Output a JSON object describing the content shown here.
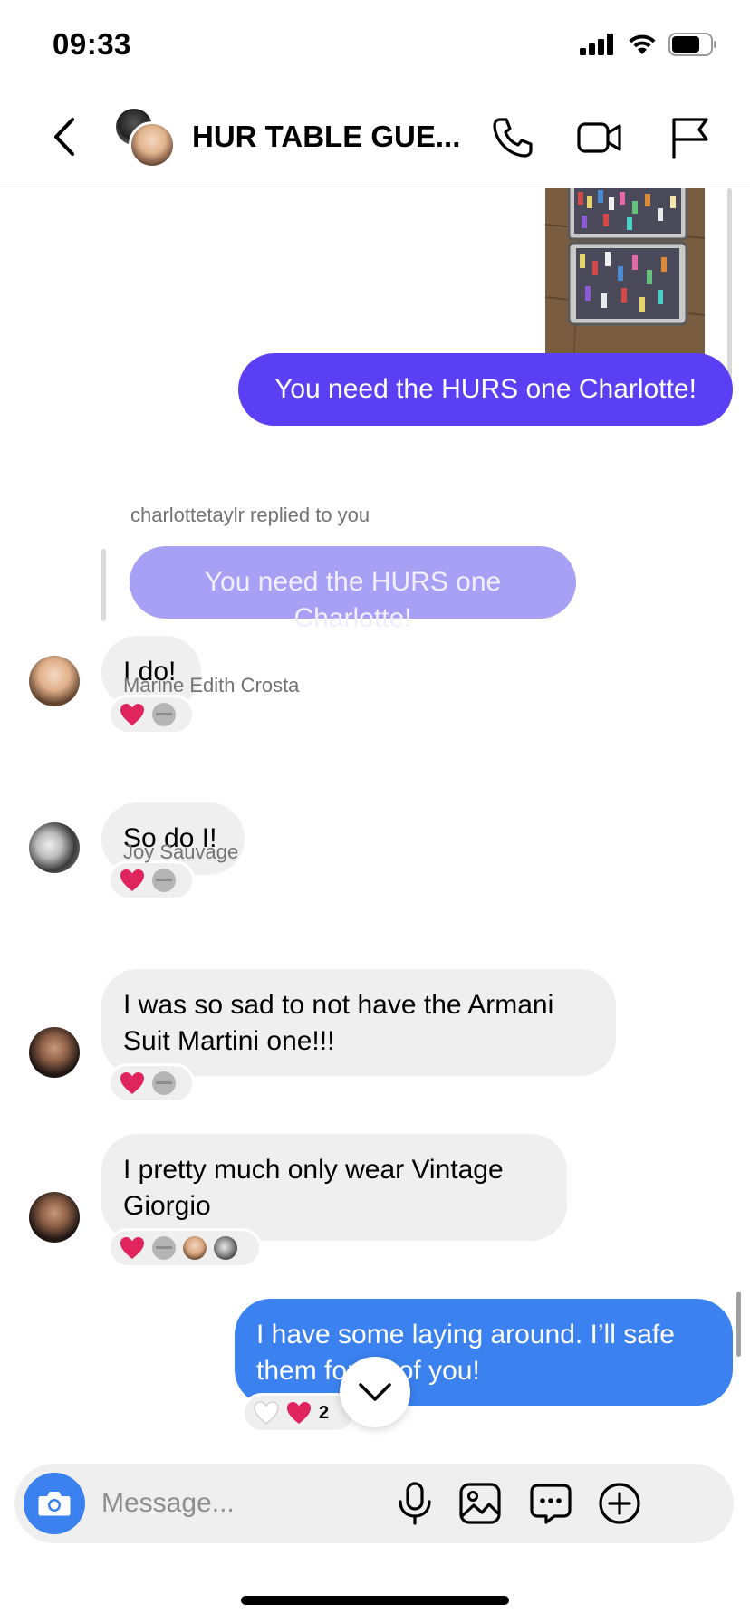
{
  "status_bar": {
    "time": "09:33"
  },
  "header": {
    "title": "HUR TABLE GUE...",
    "icons": [
      "back-chevron-icon",
      "phone-icon",
      "video-camera-icon",
      "flag-icon"
    ]
  },
  "messages": [
    {
      "id": "m1",
      "type": "outgoing",
      "text": "You need the HURS one Charlotte!",
      "color": "#5b3ff5"
    },
    {
      "id": "m2",
      "type": "reply-meta",
      "text": "charlottetaylr replied to you"
    },
    {
      "id": "m3",
      "type": "quoted",
      "text": "You need the HURS one Charlotte!"
    },
    {
      "id": "m4",
      "type": "incoming",
      "text": "I do!",
      "avatar": "charlottetaylr-avatar"
    },
    {
      "id": "m5",
      "type": "sender-name",
      "text": "Marine Edith Crosta"
    },
    {
      "id": "m6",
      "type": "incoming",
      "text": "So do I!",
      "avatar": "marine-avatar"
    },
    {
      "id": "m7",
      "type": "sender-name",
      "text": "Joy Sauvage"
    },
    {
      "id": "m8",
      "type": "incoming",
      "text": "I was so sad to not have the Armani Suit Martini one!!!",
      "avatar": "joy-avatar"
    },
    {
      "id": "m9",
      "type": "incoming",
      "text": "I pretty much only wear Vintage Giorgio",
      "avatar": "joy-avatar"
    },
    {
      "id": "m10",
      "type": "outgoing",
      "text": "I have some laying around. I’ll safe them for all of you!",
      "color": "#3b82f0",
      "reaction_count": "2"
    }
  ],
  "composer": {
    "placeholder": "Message..."
  },
  "colors": {
    "outgoing_purple": "#5b3ff5",
    "outgoing_blue": "#3b82f0",
    "incoming_bg": "#efefef",
    "meta_text": "#737373",
    "heart": "#e0245e"
  }
}
